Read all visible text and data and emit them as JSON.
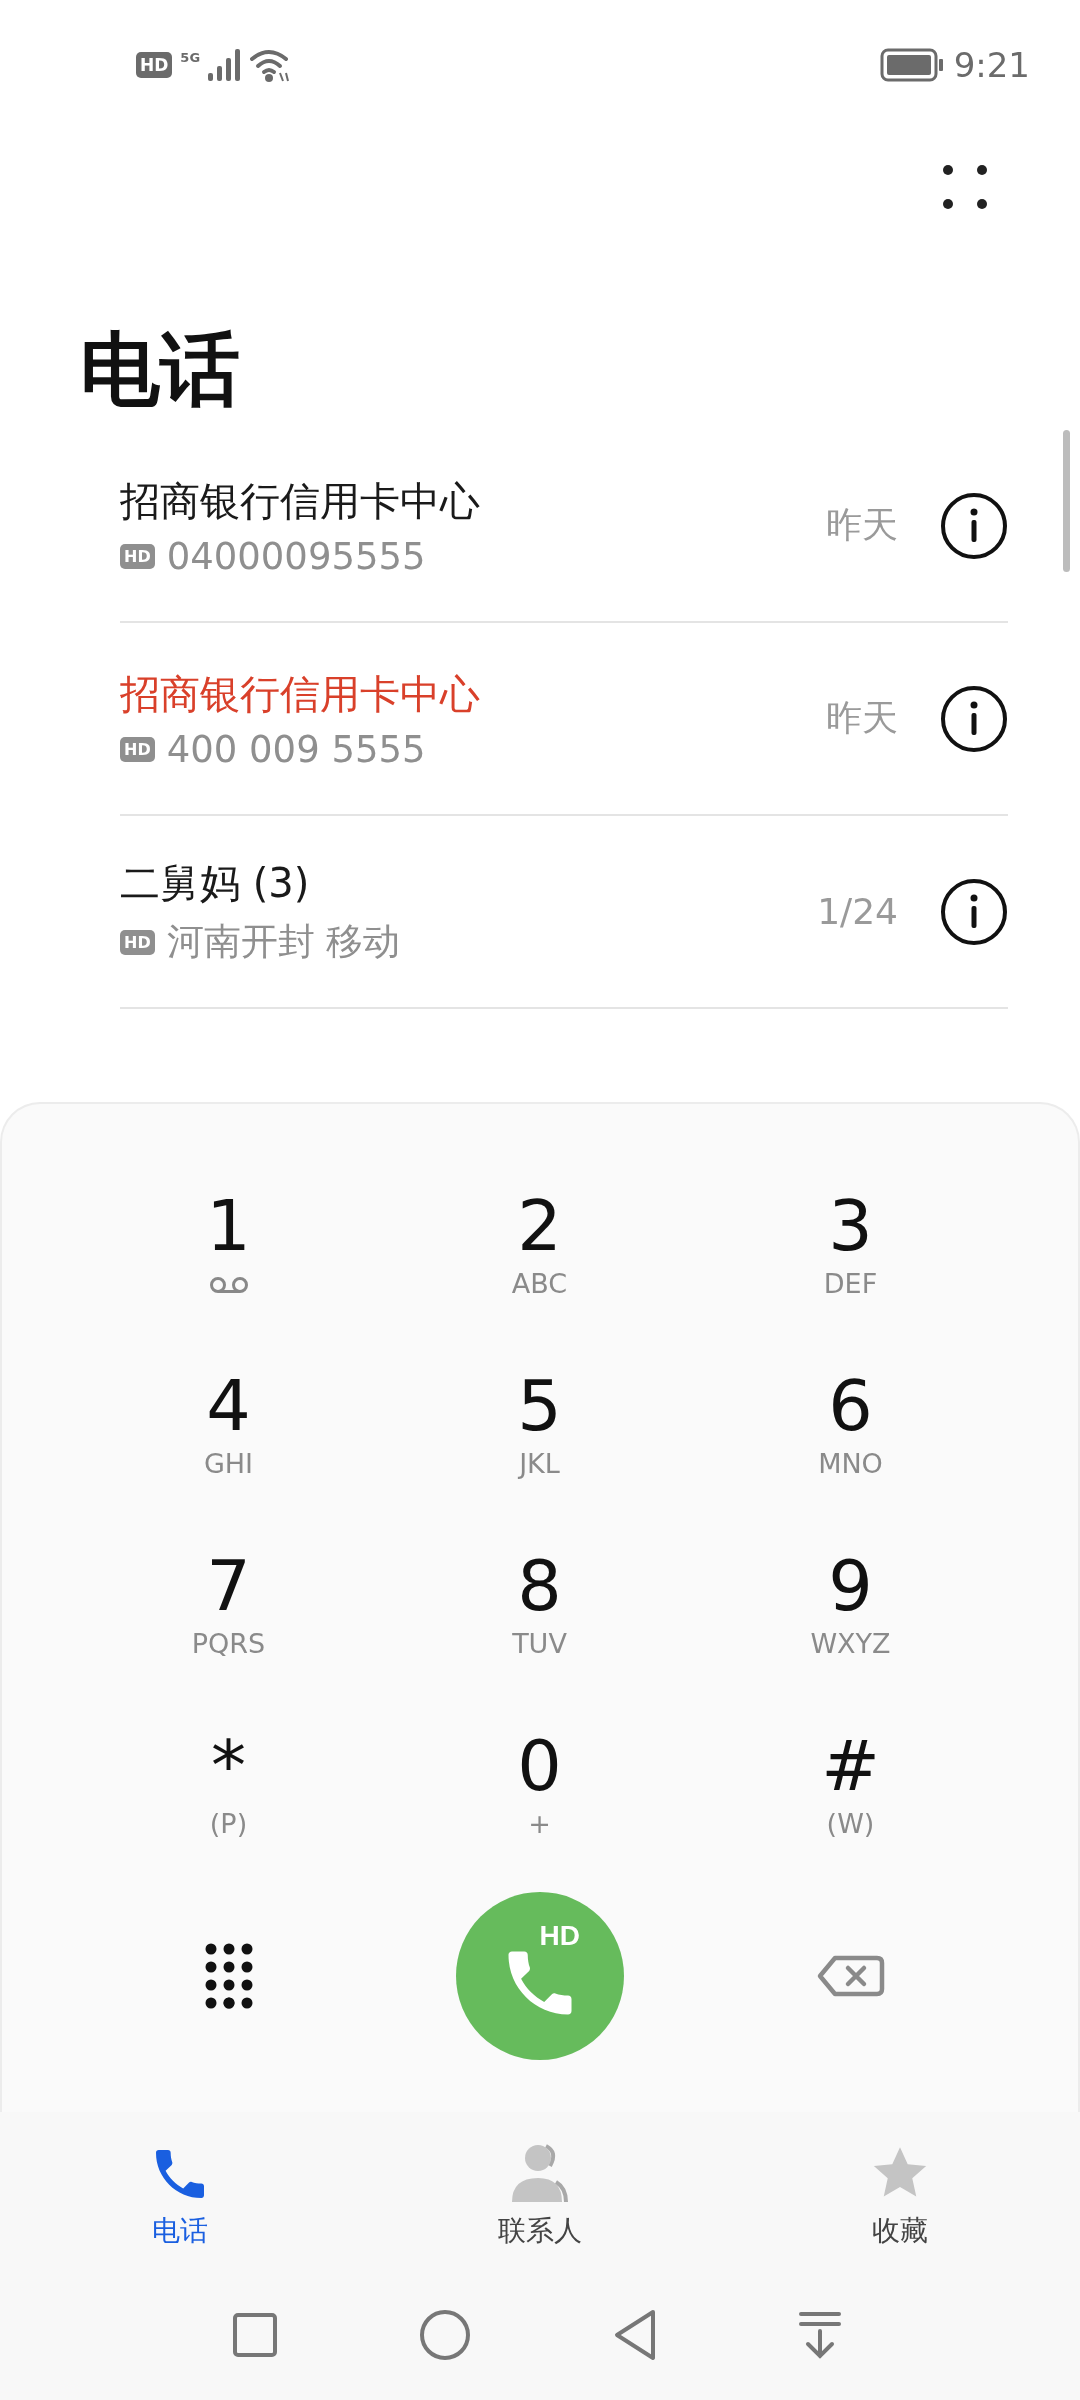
{
  "status_bar": {
    "hd": "HD",
    "network": "5G",
    "time": "9:21"
  },
  "title": "电话",
  "calls": [
    {
      "name": "招商银行信用卡中心",
      "missed": false,
      "badge": "HD",
      "detail": "04000095555",
      "date": "昨天"
    },
    {
      "name": "招商银行信用卡中心",
      "missed": true,
      "badge": "HD",
      "detail": "400 009 5555",
      "date": "昨天"
    },
    {
      "name": "二舅妈 (3)",
      "missed": false,
      "badge": "HD",
      "detail": "河南开封 移动",
      "date": "1/24"
    }
  ],
  "keypad": [
    {
      "digit": "1",
      "kind": "voicemail"
    },
    {
      "digit": "2",
      "kind": "letters",
      "letters": "ABC"
    },
    {
      "digit": "3",
      "kind": "letters",
      "letters": "DEF"
    },
    {
      "digit": "4",
      "kind": "letters",
      "letters": "GHI"
    },
    {
      "digit": "5",
      "kind": "letters",
      "letters": "JKL"
    },
    {
      "digit": "6",
      "kind": "letters",
      "letters": "MNO"
    },
    {
      "digit": "7",
      "kind": "letters",
      "letters": "PQRS"
    },
    {
      "digit": "8",
      "kind": "letters",
      "letters": "TUV"
    },
    {
      "digit": "9",
      "kind": "letters",
      "letters": "WXYZ"
    },
    {
      "digit": "*",
      "kind": "letters",
      "letters": "(P)"
    },
    {
      "digit": "0",
      "kind": "letters",
      "letters": "+"
    },
    {
      "digit": "#",
      "kind": "letters",
      "letters": "(W)"
    }
  ],
  "call_button": {
    "badge": "HD"
  },
  "tabs": [
    {
      "label": "电话",
      "kind": "phone",
      "selected": true
    },
    {
      "label": "联系人",
      "kind": "contacts",
      "selected": false
    },
    {
      "label": "收藏",
      "kind": "favorites",
      "selected": false
    }
  ]
}
